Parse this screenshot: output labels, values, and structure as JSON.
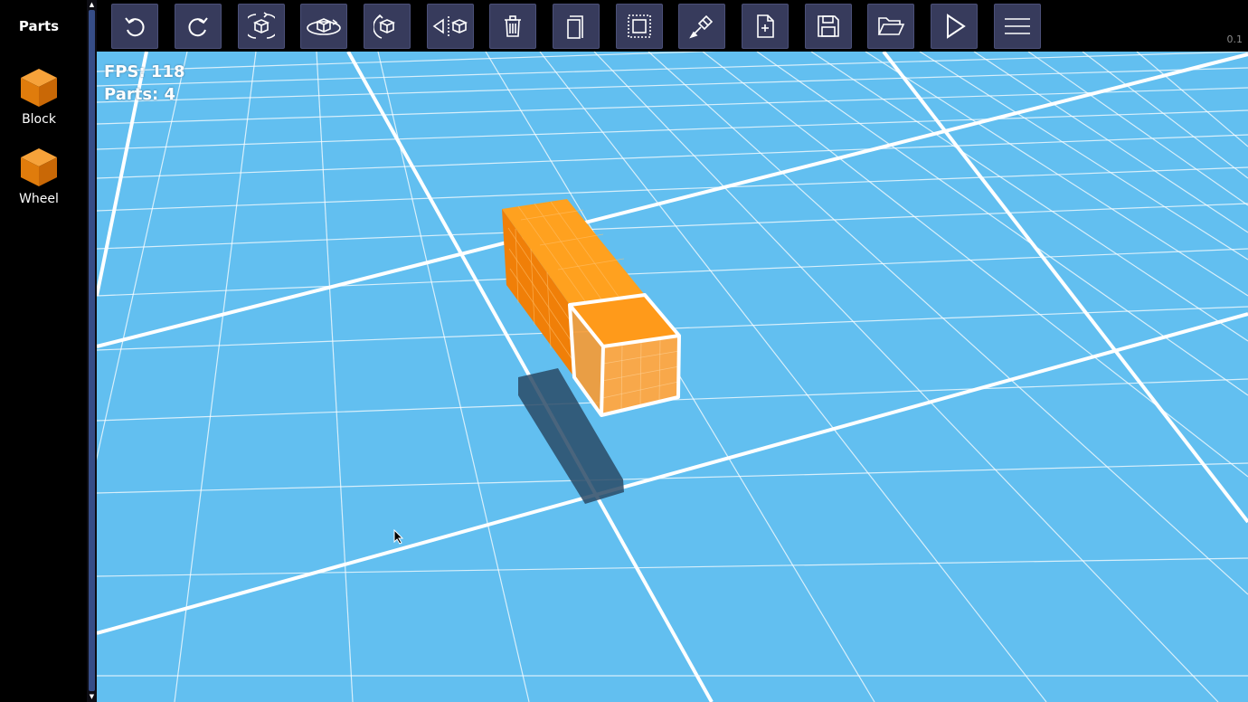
{
  "sidebar": {
    "title": "Parts",
    "items": [
      {
        "label": "Block",
        "icon": "orange-cube-icon"
      },
      {
        "label": "Wheel",
        "icon": "orange-cube-icon"
      }
    ]
  },
  "toolbar": {
    "buttons": [
      {
        "name": "undo-button",
        "icon": "undo-icon"
      },
      {
        "name": "redo-button",
        "icon": "redo-icon"
      },
      {
        "name": "rotate-vertical-button",
        "icon": "rotate-cube-vertical-icon"
      },
      {
        "name": "rotate-horizontal-button",
        "icon": "rotate-cube-horizontal-icon"
      },
      {
        "name": "rotate-roll-button",
        "icon": "rotate-cube-roll-icon"
      },
      {
        "name": "mirror-button",
        "icon": "mirror-cube-icon"
      },
      {
        "name": "delete-button",
        "icon": "trash-icon"
      },
      {
        "name": "copy-button",
        "icon": "copy-icon"
      },
      {
        "name": "select-button",
        "icon": "selection-box-icon"
      },
      {
        "name": "paint-button",
        "icon": "paint-brush-icon"
      },
      {
        "name": "new-file-button",
        "icon": "new-file-icon"
      },
      {
        "name": "save-button",
        "icon": "save-icon"
      },
      {
        "name": "open-button",
        "icon": "open-folder-icon"
      },
      {
        "name": "play-button",
        "icon": "play-icon"
      },
      {
        "name": "menu-button",
        "icon": "hamburger-menu-icon"
      }
    ]
  },
  "version": "0.1",
  "hud": {
    "fps": "FPS: 118",
    "parts": "Parts: 4"
  },
  "colors": {
    "ground": "#62bff0",
    "grid_line": "#ffffff",
    "part_orange": "#ff8c00",
    "toolbar_button": "#373b5c",
    "scroll_thumb": "#364d87"
  }
}
